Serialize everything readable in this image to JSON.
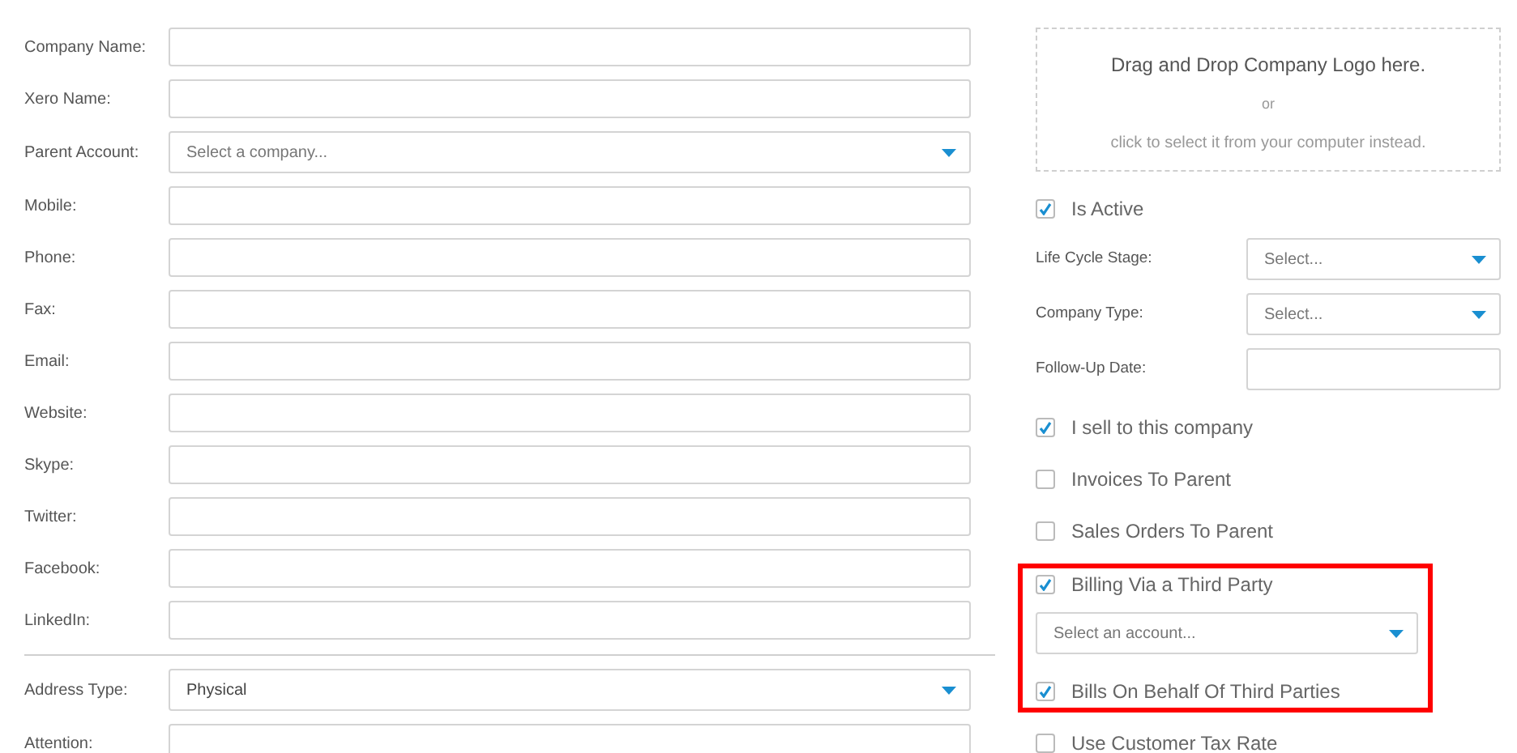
{
  "left_fields": [
    {
      "label": "Company Name:",
      "kind": "text"
    },
    {
      "label": "Xero Name:",
      "kind": "text"
    },
    {
      "label": "Parent Account:",
      "kind": "select",
      "placeholder": "Select a company..."
    },
    {
      "label": "Mobile:",
      "kind": "text"
    },
    {
      "label": "Phone:",
      "kind": "text"
    },
    {
      "label": "Fax:",
      "kind": "text"
    },
    {
      "label": "Email:",
      "kind": "text"
    },
    {
      "label": "Website:",
      "kind": "text"
    },
    {
      "label": "Skype:",
      "kind": "text"
    },
    {
      "label": "Twitter:",
      "kind": "text"
    },
    {
      "label": "Facebook:",
      "kind": "text"
    },
    {
      "label": "LinkedIn:",
      "kind": "text"
    }
  ],
  "address_fields": [
    {
      "label": "Address Type:",
      "kind": "select",
      "value": "Physical"
    },
    {
      "label": "Attention:",
      "kind": "text"
    }
  ],
  "logo_drop": {
    "title": "Drag and Drop Company Logo here.",
    "separator": "or",
    "hint": "click to select it from your computer instead."
  },
  "right_items": [
    {
      "kind": "checkbox",
      "label": "Is Active",
      "checked": true
    },
    {
      "kind": "select",
      "label": "Life Cycle Stage:",
      "placeholder": "Select..."
    },
    {
      "kind": "select",
      "label": "Company Type:",
      "placeholder": "Select..."
    },
    {
      "kind": "text",
      "label": "Follow-Up Date:"
    },
    {
      "kind": "checkbox",
      "label": "I sell to this company",
      "checked": true
    },
    {
      "kind": "checkbox",
      "label": "Invoices To Parent",
      "checked": false
    },
    {
      "kind": "checkbox",
      "label": "Sales Orders To Parent",
      "checked": false
    }
  ],
  "highlighted_group": [
    {
      "kind": "checkbox",
      "label": "Billing Via a Third Party",
      "checked": true
    },
    {
      "kind": "account_select",
      "placeholder": "Select an account..."
    },
    {
      "kind": "checkbox",
      "label": "Bills On Behalf Of Third Parties",
      "checked": true
    }
  ],
  "after_items": [
    {
      "kind": "checkbox",
      "label": "Use Customer Tax Rate",
      "checked": false
    }
  ]
}
